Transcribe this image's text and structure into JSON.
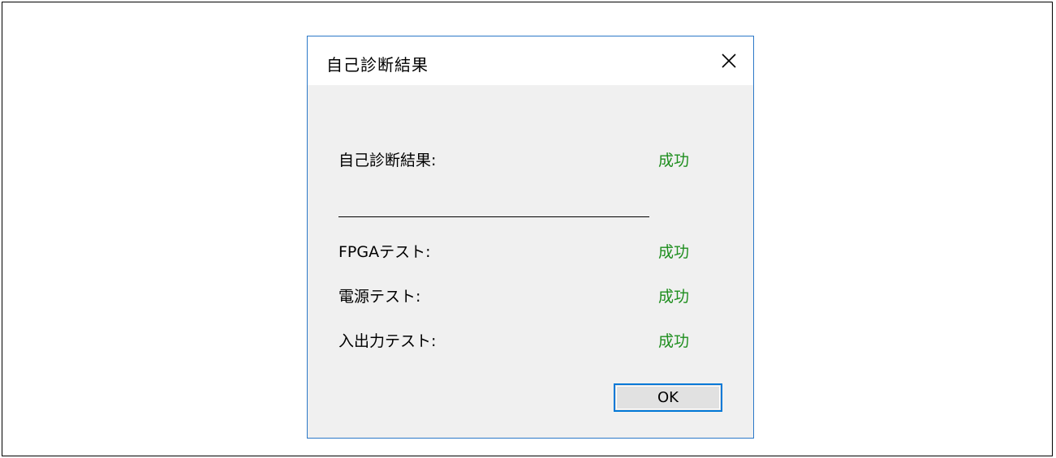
{
  "dialog": {
    "title": "自己診断結果",
    "close_icon": "close-icon",
    "summary": {
      "label": "自己診断結果:",
      "value": "成功"
    },
    "tests": [
      {
        "label": "FPGAテスト:",
        "value": "成功"
      },
      {
        "label": "電源テスト:",
        "value": "成功"
      },
      {
        "label": "入出力テスト:",
        "value": "成功"
      }
    ],
    "ok_label": "OK"
  },
  "colors": {
    "success": "#1e8e1e",
    "accent": "#0078d7",
    "dialog_border": "#2b78c8",
    "dialog_body": "#f0f0f0"
  }
}
